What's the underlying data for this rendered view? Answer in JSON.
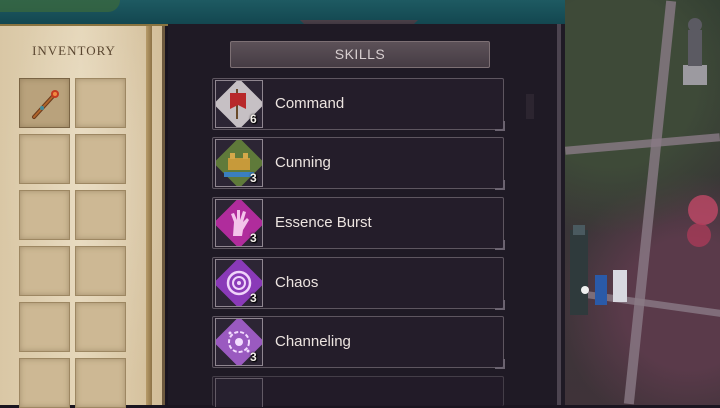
{
  "inventory": {
    "title": "INVENTORY",
    "slots": [
      {
        "item": "staff-icon"
      },
      {
        "item": null
      },
      {
        "item": null
      },
      {
        "item": null
      },
      {
        "item": null
      },
      {
        "item": null
      },
      {
        "item": null
      },
      {
        "item": null
      },
      {
        "item": null
      },
      {
        "item": null
      },
      {
        "item": null
      },
      {
        "item": null
      }
    ]
  },
  "skills": {
    "title": "SKILLS",
    "items": [
      {
        "name": "Command",
        "level": "6",
        "icon": "banner-icon"
      },
      {
        "name": "Cunning",
        "level": "3",
        "icon": "fortress-icon"
      },
      {
        "name": "Essence Burst",
        "level": "3",
        "icon": "hand-icon"
      },
      {
        "name": "Chaos",
        "level": "3",
        "icon": "spiral-icon"
      },
      {
        "name": "Channeling",
        "level": "3",
        "icon": "rune-icon"
      }
    ]
  },
  "colors": {
    "command": "#c9c3c6",
    "cunning": "#8a8a3a",
    "essence": "#b02c9c",
    "chaos": "#9c3fc2",
    "channeling": "#a565c8"
  }
}
